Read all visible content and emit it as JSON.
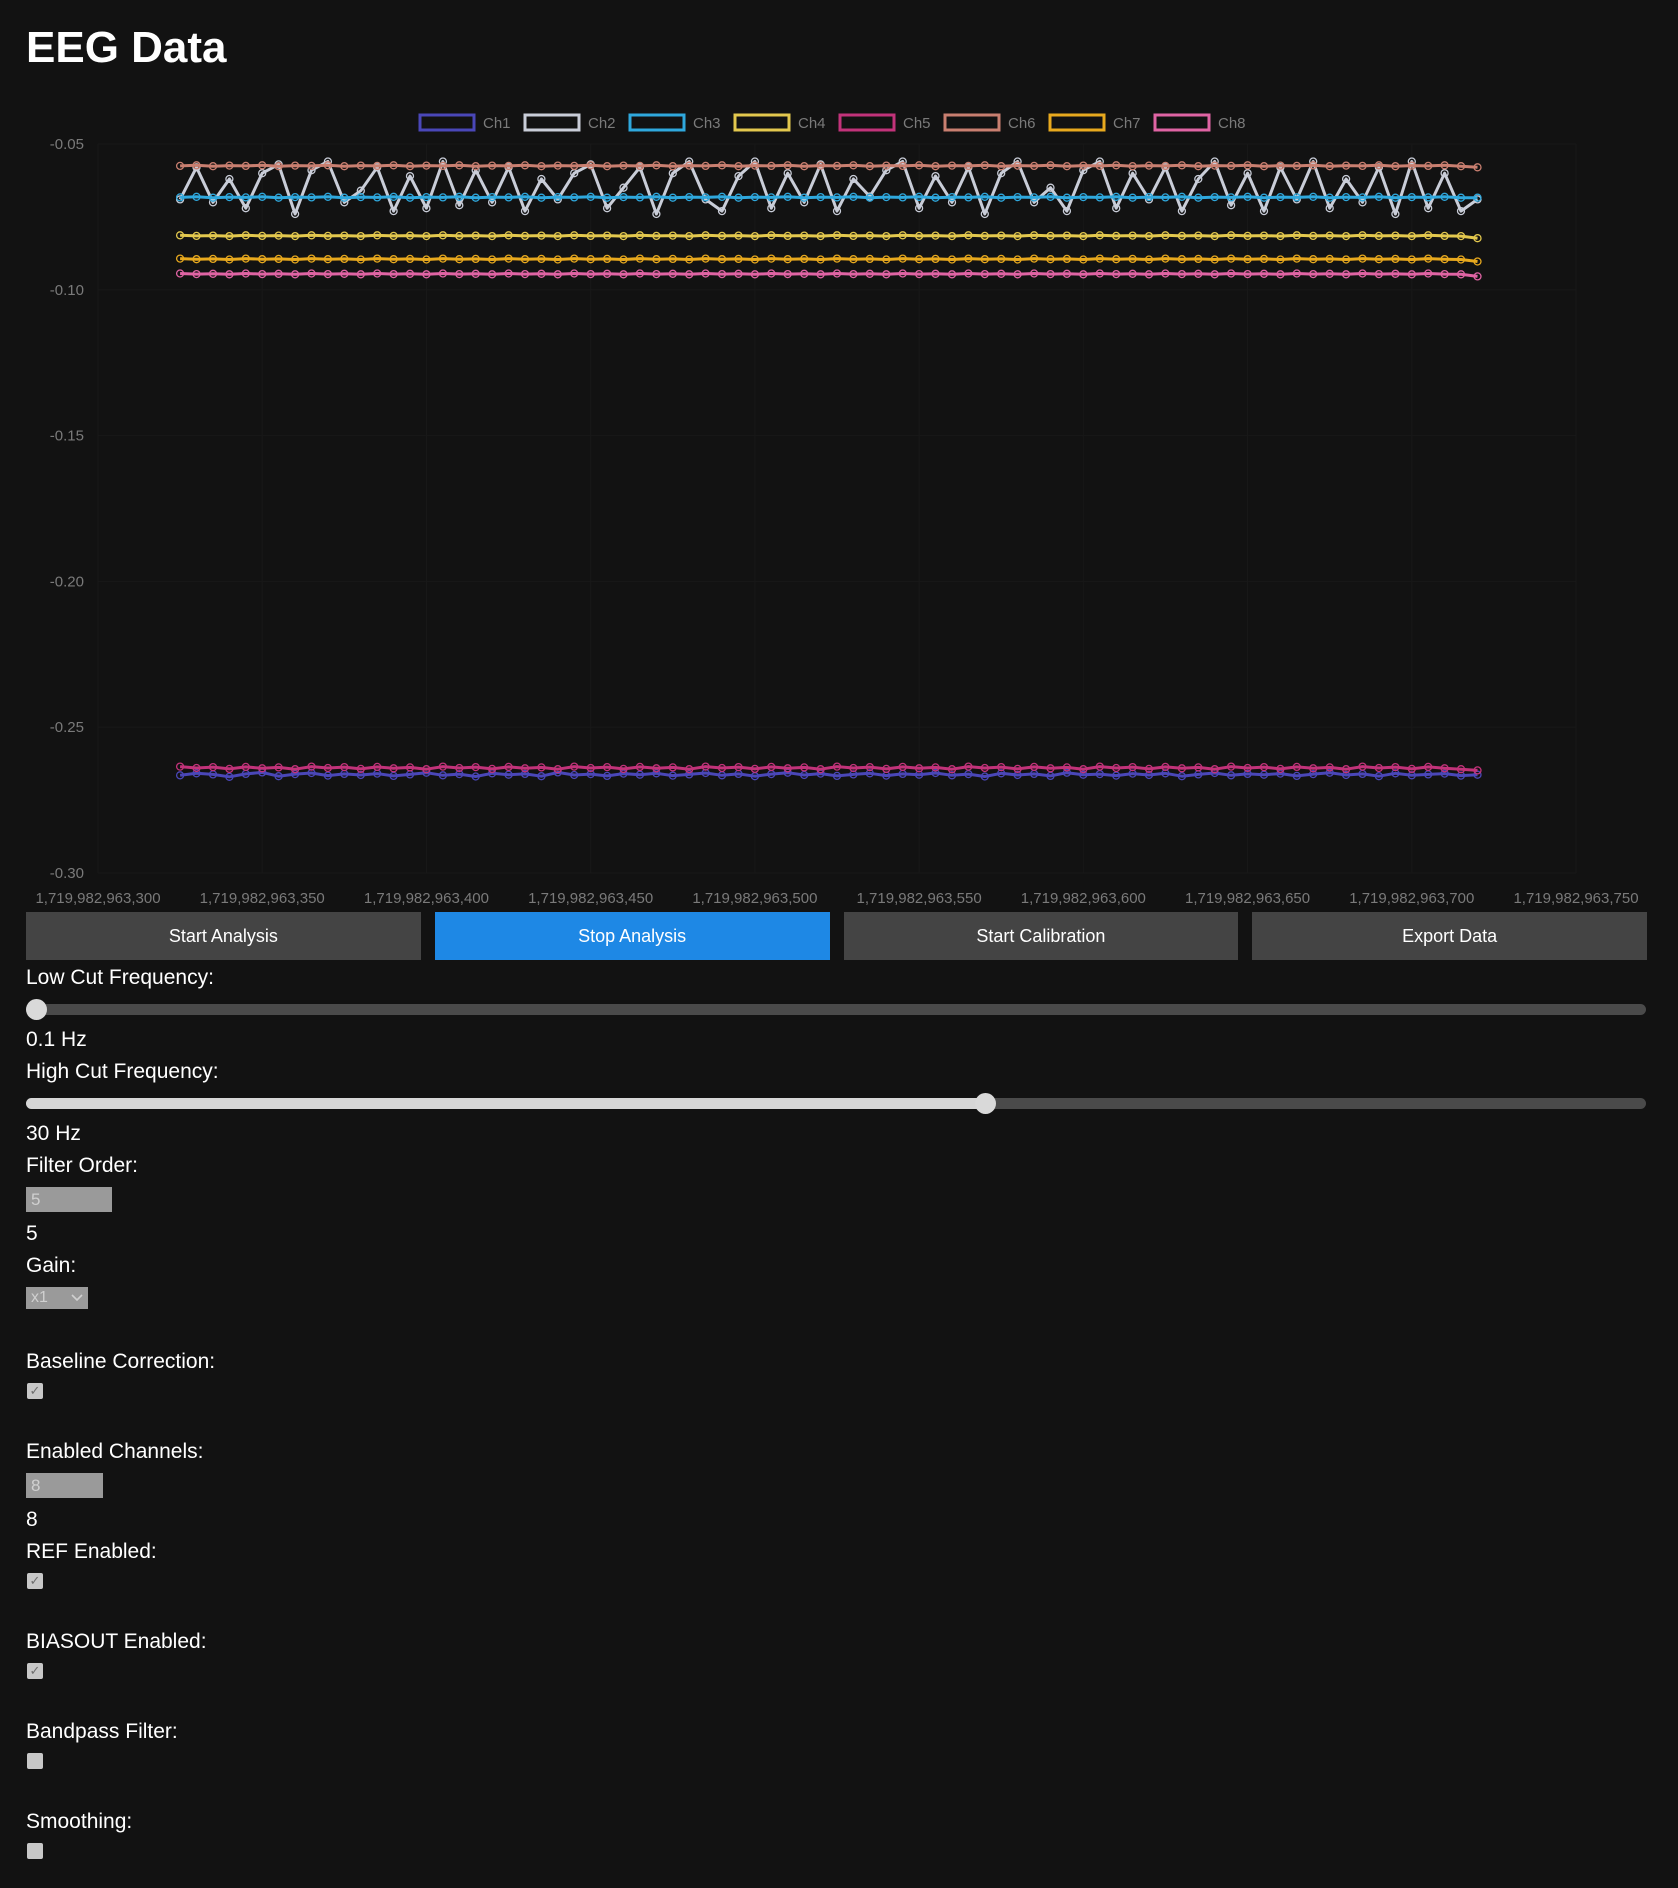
{
  "header": {
    "title": "EEG Data"
  },
  "buttons": {
    "start_analysis": "Start Analysis",
    "stop_analysis": "Stop Analysis",
    "start_calibration": "Start Calibration",
    "export_data": "Export Data"
  },
  "controls": {
    "low_cut": {
      "label": "Low Cut Frequency:",
      "value_text": "0.1 Hz",
      "level": 0.0
    },
    "high_cut": {
      "label": "High Cut Frequency:",
      "value_text": "30 Hz",
      "level": 0.592
    },
    "filter_order": {
      "label": "Filter Order:",
      "input_value": "5",
      "value_text": "5"
    },
    "gain": {
      "label": "Gain:",
      "selected": "x1"
    },
    "baseline_correction": {
      "label": "Baseline Correction:",
      "checked": true
    },
    "enabled_channels": {
      "label": "Enabled Channels:",
      "input_value": "8",
      "value_text": "8"
    },
    "ref_enabled": {
      "label": "REF Enabled:",
      "checked": true
    },
    "biasout_enabled": {
      "label": "BIASOUT Enabled:",
      "checked": true
    },
    "bandpass_filter": {
      "label": "Bandpass Filter:",
      "checked": false
    },
    "smoothing": {
      "label": "Smoothing:",
      "checked": false
    }
  },
  "colors": {
    "background": "#121212",
    "button": "#444444",
    "button_active": "#1e88e5"
  },
  "chart_data": {
    "type": "line",
    "title": "",
    "xlabel": "",
    "ylabel": "",
    "grid": true,
    "legend_position": "top-center",
    "xlim": [
      1719982963300,
      1719982963750
    ],
    "ylim": [
      -0.3,
      -0.05
    ],
    "x_ticks": [
      "1,719,982,963,300",
      "1,719,982,963,350",
      "1,719,982,963,400",
      "1,719,982,963,450",
      "1,719,982,963,500",
      "1,719,982,963,550",
      "1,719,982,963,600",
      "1,719,982,963,650",
      "1,719,982,963,700",
      "1,719,982,963,750"
    ],
    "y_ticks": [
      "-0.05",
      "-0.10",
      "-0.15",
      "-0.20",
      "-0.25",
      "-0.30"
    ],
    "x": [
      1719982963325,
      1719982963330,
      1719982963335,
      1719982963340,
      1719982963345,
      1719982963350,
      1719982963355,
      1719982963360,
      1719982963365,
      1719982963370,
      1719982963375,
      1719982963380,
      1719982963385,
      1719982963390,
      1719982963395,
      1719982963400,
      1719982963405,
      1719982963410,
      1719982963415,
      1719982963420,
      1719982963425,
      1719982963430,
      1719982963435,
      1719982963440,
      1719982963445,
      1719982963450,
      1719982963455,
      1719982963460,
      1719982963465,
      1719982963470,
      1719982963475,
      1719982963480,
      1719982963485,
      1719982963490,
      1719982963495,
      1719982963500,
      1719982963505,
      1719982963510,
      1719982963515,
      1719982963520,
      1719982963525,
      1719982963530,
      1719982963535,
      1719982963540,
      1719982963545,
      1719982963550,
      1719982963555,
      1719982963560,
      1719982963565,
      1719982963570,
      1719982963575,
      1719982963580,
      1719982963585,
      1719982963590,
      1719982963595,
      1719982963600,
      1719982963605,
      1719982963610,
      1719982963615,
      1719982963620,
      1719982963625,
      1719982963630,
      1719982963635,
      1719982963640,
      1719982963645,
      1719982963650,
      1719982963655,
      1719982963660,
      1719982963665,
      1719982963670,
      1719982963675,
      1719982963680,
      1719982963685,
      1719982963690,
      1719982963695,
      1719982963700,
      1719982963705,
      1719982963710,
      1719982963715,
      1719982963720
    ],
    "series": [
      {
        "name": "Ch1",
        "color": "#4a47b8",
        "values": [
          -0.2665,
          -0.2658,
          -0.2662,
          -0.267,
          -0.266,
          -0.2655,
          -0.2668,
          -0.2661,
          -0.2657,
          -0.2666,
          -0.266,
          -0.2664,
          -0.2659,
          -0.2667,
          -0.2662,
          -0.2656,
          -0.2665,
          -0.2661,
          -0.2669,
          -0.2658,
          -0.2663,
          -0.266,
          -0.2668,
          -0.2655,
          -0.2664,
          -0.2661,
          -0.2667,
          -0.2659,
          -0.2663,
          -0.2658,
          -0.2666,
          -0.2662,
          -0.2657,
          -0.2665,
          -0.266,
          -0.2668,
          -0.2661,
          -0.2656,
          -0.2664,
          -0.2659,
          -0.2667,
          -0.2662,
          -0.2658,
          -0.2666,
          -0.266,
          -0.2663,
          -0.2657,
          -0.2665,
          -0.2661,
          -0.2669,
          -0.2658,
          -0.2664,
          -0.266,
          -0.2667,
          -0.2656,
          -0.2663,
          -0.2661,
          -0.2666,
          -0.2659,
          -0.2664,
          -0.2658,
          -0.2668,
          -0.2662,
          -0.2657,
          -0.2665,
          -0.266,
          -0.2663,
          -0.2659,
          -0.2667,
          -0.2661,
          -0.2656,
          -0.2664,
          -0.266,
          -0.2668,
          -0.2658,
          -0.2665,
          -0.2662,
          -0.2659,
          -0.2666,
          -0.2663
        ]
      },
      {
        "name": "Ch2",
        "color": "#c9cdd8",
        "values": [
          -0.069,
          -0.058,
          -0.07,
          -0.062,
          -0.072,
          -0.06,
          -0.057,
          -0.074,
          -0.059,
          -0.056,
          -0.07,
          -0.066,
          -0.058,
          -0.073,
          -0.061,
          -0.072,
          -0.056,
          -0.071,
          -0.059,
          -0.07,
          -0.058,
          -0.073,
          -0.062,
          -0.069,
          -0.06,
          -0.057,
          -0.072,
          -0.065,
          -0.058,
          -0.074,
          -0.06,
          -0.056,
          -0.069,
          -0.073,
          -0.061,
          -0.056,
          -0.072,
          -0.06,
          -0.07,
          -0.057,
          -0.073,
          -0.062,
          -0.068,
          -0.059,
          -0.056,
          -0.072,
          -0.061,
          -0.07,
          -0.058,
          -0.074,
          -0.06,
          -0.056,
          -0.07,
          -0.065,
          -0.073,
          -0.059,
          -0.056,
          -0.072,
          -0.06,
          -0.069,
          -0.058,
          -0.073,
          -0.062,
          -0.056,
          -0.071,
          -0.06,
          -0.073,
          -0.058,
          -0.069,
          -0.056,
          -0.072,
          -0.062,
          -0.07,
          -0.058,
          -0.074,
          -0.056,
          -0.072,
          -0.06,
          -0.073,
          -0.069
        ]
      },
      {
        "name": "Ch3",
        "color": "#2fa8dd",
        "values": [
          -0.0683,
          -0.0681,
          -0.0684,
          -0.0682,
          -0.0683,
          -0.0681,
          -0.0684,
          -0.0682,
          -0.0683,
          -0.0681,
          -0.0684,
          -0.0682,
          -0.0683,
          -0.0681,
          -0.0684,
          -0.0682,
          -0.0683,
          -0.0681,
          -0.0684,
          -0.0682,
          -0.0683,
          -0.0681,
          -0.0684,
          -0.0682,
          -0.0683,
          -0.0681,
          -0.0684,
          -0.0682,
          -0.0683,
          -0.0681,
          -0.0684,
          -0.0682,
          -0.0683,
          -0.0681,
          -0.0684,
          -0.0682,
          -0.0683,
          -0.0681,
          -0.0684,
          -0.0682,
          -0.0683,
          -0.0681,
          -0.0684,
          -0.0682,
          -0.0683,
          -0.0681,
          -0.0684,
          -0.0682,
          -0.0683,
          -0.0681,
          -0.0684,
          -0.0682,
          -0.0683,
          -0.0681,
          -0.0684,
          -0.0682,
          -0.0683,
          -0.0681,
          -0.0684,
          -0.0682,
          -0.0683,
          -0.0681,
          -0.0684,
          -0.0682,
          -0.0683,
          -0.0681,
          -0.0684,
          -0.0682,
          -0.0683,
          -0.0681,
          -0.0684,
          -0.0682,
          -0.0683,
          -0.0681,
          -0.0684,
          -0.0682,
          -0.0683,
          -0.0681,
          -0.0684,
          -0.0684
        ]
      },
      {
        "name": "Ch4",
        "color": "#e3c84e",
        "values": [
          -0.0813,
          -0.0815,
          -0.0814,
          -0.0816,
          -0.0813,
          -0.0815,
          -0.0814,
          -0.0816,
          -0.0813,
          -0.0815,
          -0.0814,
          -0.0816,
          -0.0813,
          -0.0815,
          -0.0814,
          -0.0816,
          -0.0813,
          -0.0815,
          -0.0814,
          -0.0816,
          -0.0813,
          -0.0815,
          -0.0814,
          -0.0816,
          -0.0813,
          -0.0815,
          -0.0814,
          -0.0816,
          -0.0813,
          -0.0815,
          -0.0814,
          -0.0816,
          -0.0813,
          -0.0815,
          -0.0814,
          -0.0816,
          -0.0813,
          -0.0815,
          -0.0814,
          -0.0816,
          -0.0813,
          -0.0815,
          -0.0814,
          -0.0816,
          -0.0813,
          -0.0815,
          -0.0814,
          -0.0816,
          -0.0813,
          -0.0815,
          -0.0814,
          -0.0816,
          -0.0813,
          -0.0815,
          -0.0814,
          -0.0816,
          -0.0813,
          -0.0815,
          -0.0814,
          -0.0816,
          -0.0813,
          -0.0815,
          -0.0814,
          -0.0816,
          -0.0813,
          -0.0815,
          -0.0814,
          -0.0816,
          -0.0813,
          -0.0815,
          -0.0814,
          -0.0816,
          -0.0813,
          -0.0815,
          -0.0814,
          -0.0816,
          -0.0813,
          -0.0815,
          -0.0816,
          -0.0823
        ]
      },
      {
        "name": "Ch5",
        "color": "#c2337a",
        "values": [
          -0.2635,
          -0.264,
          -0.2637,
          -0.2643,
          -0.2636,
          -0.2641,
          -0.2638,
          -0.2644,
          -0.2635,
          -0.264,
          -0.2637,
          -0.2643,
          -0.2636,
          -0.2641,
          -0.2638,
          -0.2644,
          -0.2635,
          -0.264,
          -0.2637,
          -0.2643,
          -0.2636,
          -0.2641,
          -0.2638,
          -0.2644,
          -0.2635,
          -0.264,
          -0.2637,
          -0.2643,
          -0.2636,
          -0.2641,
          -0.2638,
          -0.2644,
          -0.2635,
          -0.264,
          -0.2637,
          -0.2643,
          -0.2636,
          -0.2641,
          -0.2638,
          -0.2644,
          -0.2635,
          -0.264,
          -0.2637,
          -0.2643,
          -0.2636,
          -0.2641,
          -0.2638,
          -0.2644,
          -0.2635,
          -0.264,
          -0.2637,
          -0.2643,
          -0.2636,
          -0.2641,
          -0.2638,
          -0.2644,
          -0.2635,
          -0.264,
          -0.2637,
          -0.2643,
          -0.2636,
          -0.2641,
          -0.2638,
          -0.2644,
          -0.2635,
          -0.264,
          -0.2637,
          -0.2643,
          -0.2636,
          -0.2641,
          -0.2638,
          -0.2644,
          -0.2635,
          -0.264,
          -0.2637,
          -0.2643,
          -0.2636,
          -0.2641,
          -0.2644,
          -0.2648
        ]
      },
      {
        "name": "Ch6",
        "color": "#c97f70",
        "values": [
          -0.0575,
          -0.0573,
          -0.0576,
          -0.0574,
          -0.0575,
          -0.0573,
          -0.0576,
          -0.0574,
          -0.0575,
          -0.0573,
          -0.0576,
          -0.0574,
          -0.0575,
          -0.0573,
          -0.0576,
          -0.0574,
          -0.0575,
          -0.0573,
          -0.0576,
          -0.0574,
          -0.0575,
          -0.0573,
          -0.0576,
          -0.0574,
          -0.0575,
          -0.0573,
          -0.0576,
          -0.0574,
          -0.0575,
          -0.0573,
          -0.0576,
          -0.0574,
          -0.0575,
          -0.0573,
          -0.0576,
          -0.0574,
          -0.0575,
          -0.0573,
          -0.0576,
          -0.0574,
          -0.0575,
          -0.0573,
          -0.0576,
          -0.0574,
          -0.0575,
          -0.0573,
          -0.0576,
          -0.0574,
          -0.0575,
          -0.0573,
          -0.0576,
          -0.0574,
          -0.0575,
          -0.0573,
          -0.0576,
          -0.0574,
          -0.0575,
          -0.0573,
          -0.0576,
          -0.0574,
          -0.0575,
          -0.0573,
          -0.0576,
          -0.0574,
          -0.0575,
          -0.0573,
          -0.0576,
          -0.0574,
          -0.0575,
          -0.0573,
          -0.0576,
          -0.0574,
          -0.0575,
          -0.0573,
          -0.0576,
          -0.0574,
          -0.0575,
          -0.0573,
          -0.0576,
          -0.058
        ]
      },
      {
        "name": "Ch7",
        "color": "#e8a91e",
        "values": [
          -0.0893,
          -0.0895,
          -0.0894,
          -0.0896,
          -0.0893,
          -0.0895,
          -0.0894,
          -0.0896,
          -0.0893,
          -0.0895,
          -0.0894,
          -0.0896,
          -0.0893,
          -0.0895,
          -0.0894,
          -0.0896,
          -0.0893,
          -0.0895,
          -0.0894,
          -0.0896,
          -0.0893,
          -0.0895,
          -0.0894,
          -0.0896,
          -0.0893,
          -0.0895,
          -0.0894,
          -0.0896,
          -0.0893,
          -0.0895,
          -0.0894,
          -0.0896,
          -0.0893,
          -0.0895,
          -0.0894,
          -0.0896,
          -0.0893,
          -0.0895,
          -0.0894,
          -0.0896,
          -0.0893,
          -0.0895,
          -0.0894,
          -0.0896,
          -0.0893,
          -0.0895,
          -0.0894,
          -0.0896,
          -0.0893,
          -0.0895,
          -0.0894,
          -0.0896,
          -0.0893,
          -0.0895,
          -0.0894,
          -0.0896,
          -0.0893,
          -0.0895,
          -0.0894,
          -0.0896,
          -0.0893,
          -0.0895,
          -0.0894,
          -0.0896,
          -0.0893,
          -0.0895,
          -0.0894,
          -0.0896,
          -0.0893,
          -0.0895,
          -0.0894,
          -0.0896,
          -0.0893,
          -0.0895,
          -0.0894,
          -0.0896,
          -0.0893,
          -0.0895,
          -0.0896,
          -0.0903
        ]
      },
      {
        "name": "Ch8",
        "color": "#e064a4",
        "values": [
          -0.0944,
          -0.0946,
          -0.0945,
          -0.0947,
          -0.0944,
          -0.0946,
          -0.0945,
          -0.0947,
          -0.0944,
          -0.0946,
          -0.0945,
          -0.0947,
          -0.0944,
          -0.0946,
          -0.0945,
          -0.0947,
          -0.0944,
          -0.0946,
          -0.0945,
          -0.0947,
          -0.0944,
          -0.0946,
          -0.0945,
          -0.0947,
          -0.0944,
          -0.0946,
          -0.0945,
          -0.0947,
          -0.0944,
          -0.0946,
          -0.0945,
          -0.0947,
          -0.0944,
          -0.0946,
          -0.0945,
          -0.0947,
          -0.0944,
          -0.0946,
          -0.0945,
          -0.0947,
          -0.0944,
          -0.0946,
          -0.0945,
          -0.0947,
          -0.0944,
          -0.0946,
          -0.0945,
          -0.0947,
          -0.0944,
          -0.0946,
          -0.0945,
          -0.0947,
          -0.0944,
          -0.0946,
          -0.0945,
          -0.0947,
          -0.0944,
          -0.0946,
          -0.0945,
          -0.0947,
          -0.0944,
          -0.0946,
          -0.0945,
          -0.0947,
          -0.0944,
          -0.0946,
          -0.0945,
          -0.0947,
          -0.0944,
          -0.0946,
          -0.0945,
          -0.0947,
          -0.0944,
          -0.0946,
          -0.0945,
          -0.0947,
          -0.0944,
          -0.0946,
          -0.0947,
          -0.0954
        ]
      }
    ]
  }
}
